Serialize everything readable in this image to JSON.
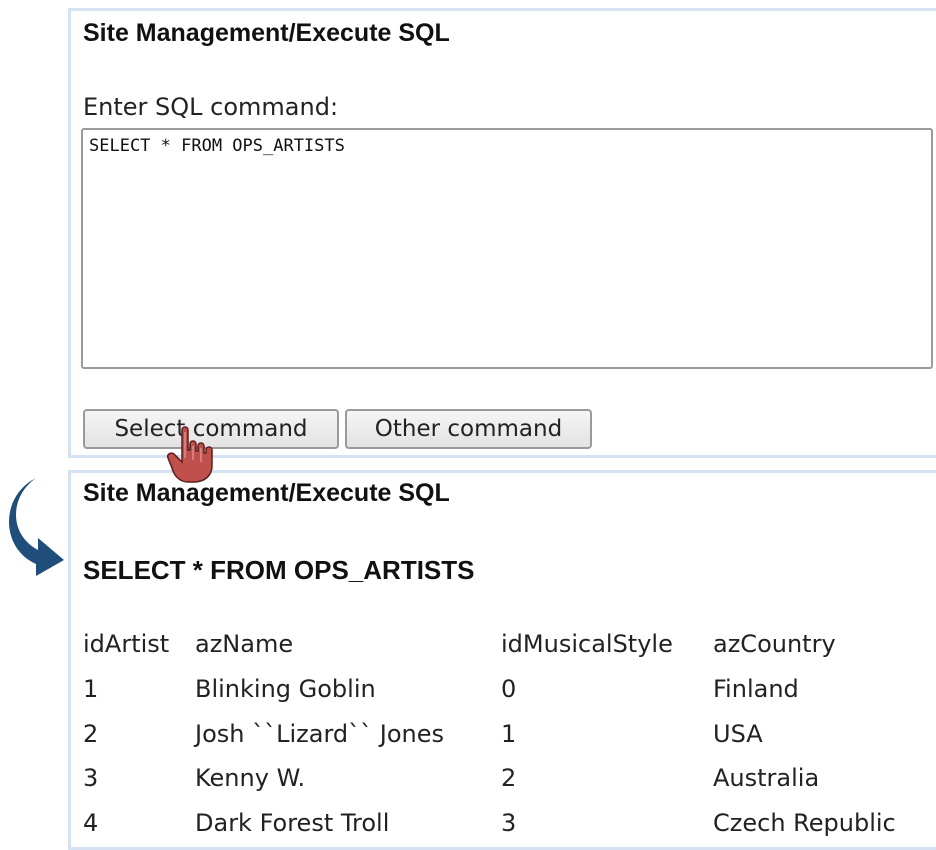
{
  "panel_top": {
    "title": "Site Management/Execute SQL",
    "prompt_label": "Enter SQL command:",
    "sql_value": "SELECT * FROM OPS_ARTISTS",
    "buttons": {
      "select_command": "Select command",
      "other_command": "Other command"
    }
  },
  "panel_bottom": {
    "title": "Site Management/Execute SQL",
    "query_echo": "SELECT * FROM OPS_ARTISTS",
    "table": {
      "headers": [
        "idArtist",
        "azName",
        "idMusicalStyle",
        "azCountry"
      ],
      "rows": [
        [
          "1",
          "Blinking Goblin",
          "0",
          "Finland"
        ],
        [
          "2",
          "Josh ``Lizard`` Jones",
          "1",
          "USA"
        ],
        [
          "3",
          "Kenny W.",
          "2",
          "Australia"
        ],
        [
          "4",
          "Dark Forest Troll",
          "3",
          "Czech Republic"
        ]
      ]
    }
  },
  "icons": {
    "cursor": "hand-pointer-icon",
    "arrow": "curved-down-arrow-icon"
  },
  "colors": {
    "panel_border": "#d4e2f4",
    "arrow": "#1f4e7a",
    "cursor": "#c0504d"
  }
}
